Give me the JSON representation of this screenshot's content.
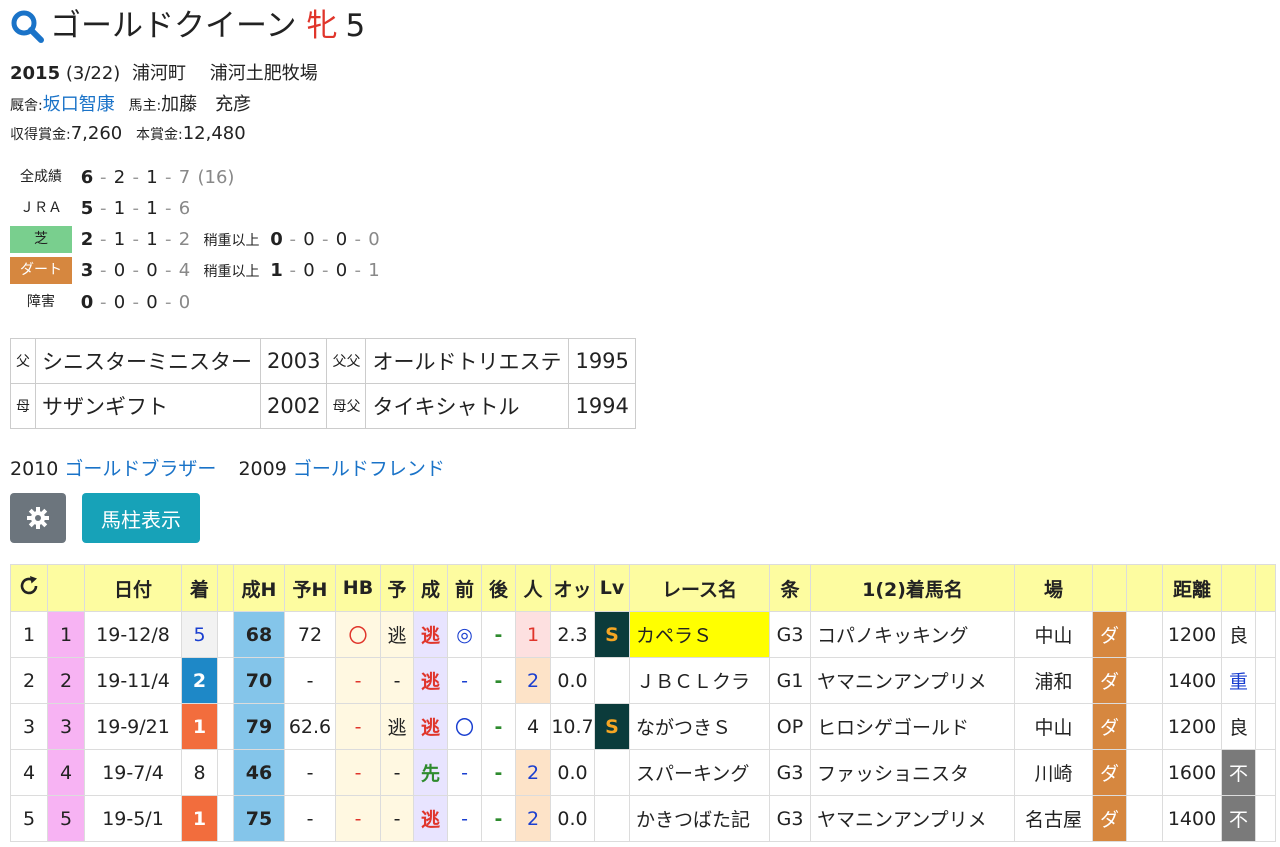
{
  "horse": {
    "name": "ゴールドクイーン",
    "sex": "牝",
    "age": "5"
  },
  "birth": {
    "year": "2015",
    "date": "(3/22)",
    "town": "浦河町",
    "breeder": "浦河土肥牧場"
  },
  "staff": {
    "stable_label": "厩舎:",
    "trainer": "坂口智康",
    "owner_label": "馬主:",
    "owner": "加藤　充彦"
  },
  "earnings": {
    "shutoku_label": "収得賞金:",
    "shutoku": "7,260",
    "hon_label": "本賞金:",
    "hon": "12,480"
  },
  "records": {
    "all": {
      "label": "全成績",
      "r": [
        "6",
        "2",
        "1",
        "7"
      ],
      "total": "(16)"
    },
    "jra": {
      "label": "ＪＲＡ",
      "r": [
        "5",
        "1",
        "1",
        "6"
      ]
    },
    "turf": {
      "label": "芝",
      "r": [
        "2",
        "1",
        "1",
        "2"
      ],
      "heavy_label": "稍重以上",
      "heavy": [
        "0",
        "0",
        "0",
        "0"
      ]
    },
    "dirt": {
      "label": "ダート",
      "r": [
        "3",
        "0",
        "0",
        "4"
      ],
      "heavy_label": "稍重以上",
      "heavy": [
        "1",
        "0",
        "0",
        "1"
      ]
    },
    "jump": {
      "label": "障害",
      "r": [
        "0",
        "0",
        "0",
        "0"
      ]
    }
  },
  "pedigree": {
    "sire_label": "父",
    "sire": "シニスターミニスター",
    "sire_year": "2003",
    "sire_sire_label": "父父",
    "sire_sire": "オールドトリエステ",
    "sire_sire_year": "1995",
    "dam_label": "母",
    "dam": "サザンギフト",
    "dam_year": "2002",
    "dam_sire_label": "母父",
    "dam_sire": "タイキシャトル",
    "dam_sire_year": "1994"
  },
  "siblings": [
    {
      "year": "2010",
      "name": "ゴールドブラザー"
    },
    {
      "year": "2009",
      "name": "ゴールドフレンド"
    }
  ],
  "buttons": {
    "settings_icon": "gear-icon",
    "umabashira": "馬柱表示"
  },
  "table": {
    "headers": [
      "",
      "",
      "日付",
      "着",
      "",
      "成H",
      "予H",
      "HB",
      "予",
      "成",
      "前",
      "後",
      "人",
      "オッ",
      "Lv",
      "レース名",
      "条",
      "1(2)着馬名",
      "場",
      "",
      "",
      "距離",
      "",
      ""
    ],
    "rows": [
      {
        "no": "1",
        "no2": "1",
        "date": "19-12/8",
        "rank": "5",
        "seiH": "68",
        "yoH": "72",
        "hb": "〇",
        "yo": "逃",
        "sei": "逃",
        "mae": "◎",
        "ato": "-",
        "pop": "1",
        "odds": "2.3",
        "lv": "S",
        "race": "カペラＳ",
        "grade": "G3",
        "winner": "コパノキッキング",
        "venue": "中山",
        "surface": "ダ",
        "dist": "1200",
        "cond": "良"
      },
      {
        "no": "2",
        "no2": "2",
        "date": "19-11/4",
        "rank": "2",
        "seiH": "70",
        "yoH": "-",
        "hb": "-",
        "yo": "-",
        "sei": "逃",
        "mae": "-",
        "ato": "-",
        "pop": "2",
        "odds": "0.0",
        "lv": "",
        "race": "ＪＢＣＬクラ",
        "grade": "G1",
        "winner": "ヤマニンアンプリメ",
        "venue": "浦和",
        "surface": "ダ",
        "dist": "1400",
        "cond": "重"
      },
      {
        "no": "3",
        "no2": "3",
        "date": "19-9/21",
        "rank": "1",
        "seiH": "79",
        "yoH": "62.6",
        "hb": "-",
        "yo": "逃",
        "sei": "逃",
        "mae": "〇",
        "ato": "-",
        "pop": "4",
        "odds": "10.7",
        "lv": "S",
        "race": "ながつきＳ",
        "grade": "OP",
        "winner": "ヒロシゲゴールド",
        "venue": "中山",
        "surface": "ダ",
        "dist": "1200",
        "cond": "良"
      },
      {
        "no": "4",
        "no2": "4",
        "date": "19-7/4",
        "rank": "8",
        "seiH": "46",
        "yoH": "-",
        "hb": "-",
        "yo": "-",
        "sei": "先",
        "mae": "-",
        "ato": "-",
        "pop": "2",
        "odds": "0.0",
        "lv": "",
        "race": "スパーキング",
        "grade": "G3",
        "winner": "ファッショニスタ",
        "venue": "川崎",
        "surface": "ダ",
        "dist": "1600",
        "cond": "不"
      },
      {
        "no": "5",
        "no2": "5",
        "date": "19-5/1",
        "rank": "1",
        "seiH": "75",
        "yoH": "-",
        "hb": "-",
        "yo": "-",
        "sei": "逃",
        "mae": "-",
        "ato": "-",
        "pop": "2",
        "odds": "0.0",
        "lv": "",
        "race": "かきつばた記",
        "grade": "G3",
        "winner": "ヤマニンアンプリメ",
        "venue": "名古屋",
        "surface": "ダ",
        "dist": "1400",
        "cond": "不"
      }
    ]
  }
}
